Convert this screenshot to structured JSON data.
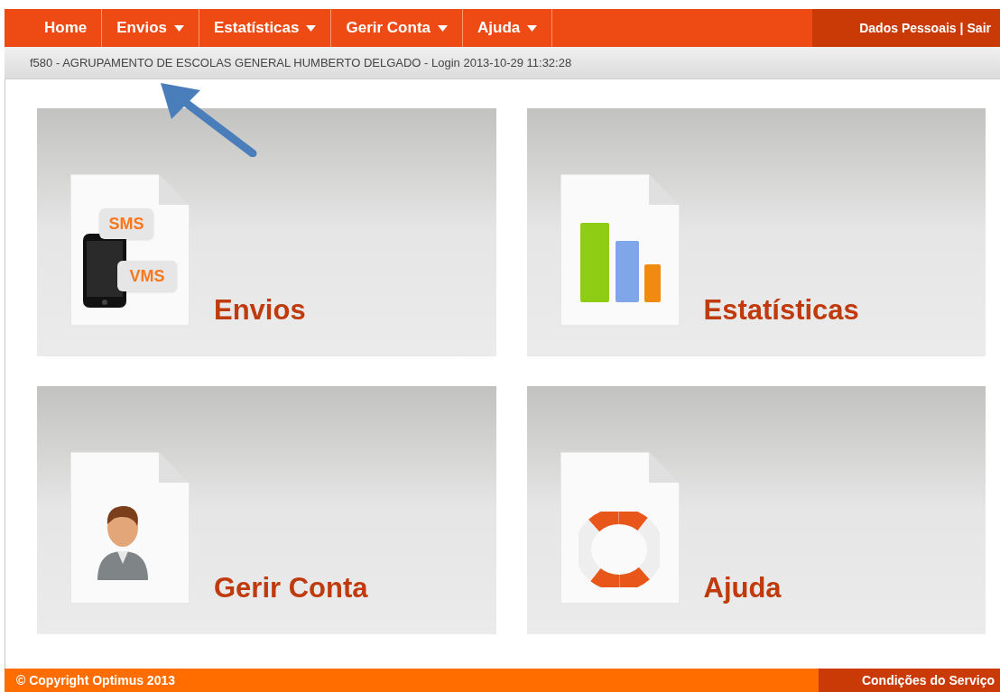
{
  "nav": {
    "items": [
      {
        "label": "Home",
        "has_menu": false
      },
      {
        "label": "Envios",
        "has_menu": true
      },
      {
        "label": "Estatísticas",
        "has_menu": true
      },
      {
        "label": "Gerir Conta",
        "has_menu": true
      },
      {
        "label": "Ajuda",
        "has_menu": true
      }
    ],
    "account_links": [
      {
        "label": "Dados Pessoais"
      },
      {
        "label": "Sair"
      }
    ],
    "separator": "|"
  },
  "session_bar": "f580 - AGRUPAMENTO DE ESCOLAS GENERAL HUMBERTO DELGADO - Login 2013-10-29 11:32:28",
  "tiles": [
    {
      "kind": "messages",
      "title": "Envios",
      "badges": [
        "SMS",
        "VMS"
      ]
    },
    {
      "kind": "stats",
      "title": "Estatísticas"
    },
    {
      "kind": "account",
      "title": "Gerir Conta"
    },
    {
      "kind": "help",
      "title": "Ajuda"
    }
  ],
  "annotation": {
    "arrow": true
  },
  "footer": {
    "copyright": "© Copyright Optimus 2013",
    "terms": "Condições do Serviço"
  }
}
